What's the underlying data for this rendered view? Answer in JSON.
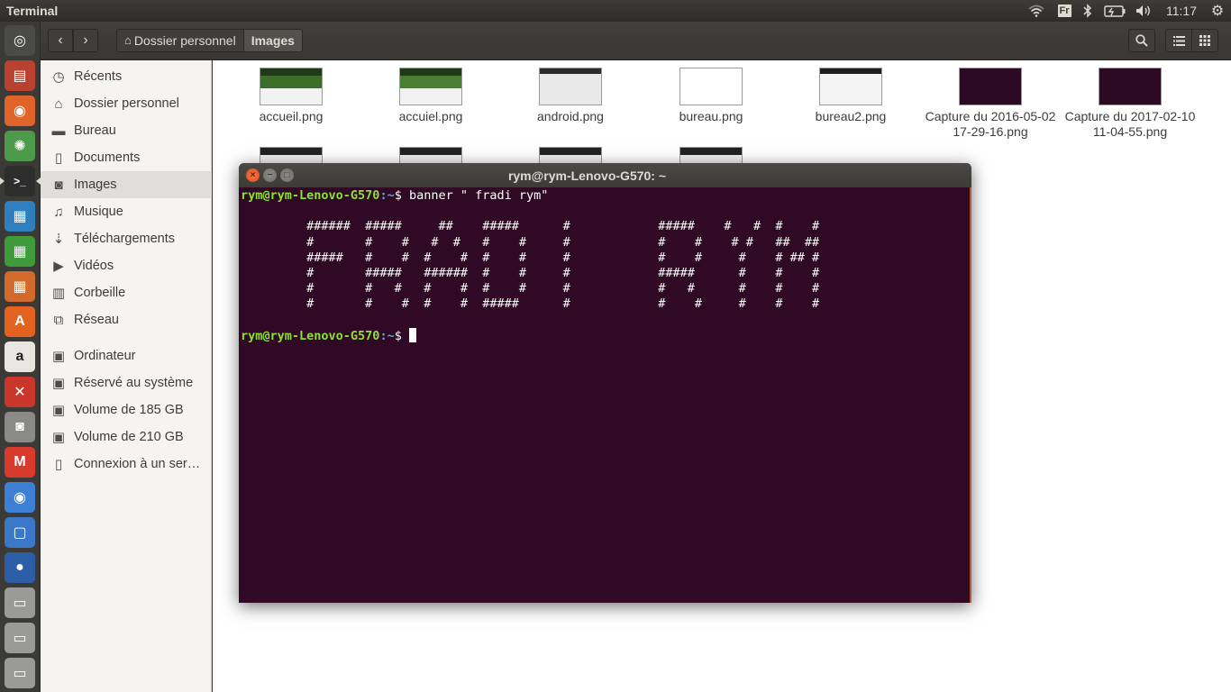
{
  "top_panel": {
    "app_title": "Terminal",
    "keyboard_layout": "Fr",
    "clock": "11:17"
  },
  "launcher": {
    "items": [
      {
        "name": "ubuntu-dash-icon",
        "color": "#4a4a48"
      },
      {
        "name": "file-manager-icon",
        "color": "#b8422f"
      },
      {
        "name": "firefox-icon",
        "color": "#e0632a"
      },
      {
        "name": "ubuntu-software-icon",
        "color": "#4c9a4a"
      },
      {
        "name": "terminal-icon",
        "color": "#2d2d2d"
      },
      {
        "name": "libreoffice-writer-icon",
        "color": "#2f7fc0"
      },
      {
        "name": "libreoffice-calc-icon",
        "color": "#3e9a3a"
      },
      {
        "name": "libreoffice-impress-icon",
        "color": "#d26a2b"
      },
      {
        "name": "software-center-icon",
        "color": "#e3621f"
      },
      {
        "name": "amazon-icon",
        "color": "#e8e6e1"
      },
      {
        "name": "system-settings-icon",
        "color": "#c9372c"
      },
      {
        "name": "camera-icon",
        "color": "#8a8a88"
      },
      {
        "name": "gmail-icon",
        "color": "#d93a2e"
      },
      {
        "name": "chromium-icon",
        "color": "#3d7fd4"
      },
      {
        "name": "screen-icon",
        "color": "#3c78c8"
      },
      {
        "name": "webcam-icon",
        "color": "#2c5ea8"
      },
      {
        "name": "drive-1-icon",
        "color": "#9a9a98"
      },
      {
        "name": "drive-2-icon",
        "color": "#9a9a98"
      },
      {
        "name": "drive-3-icon",
        "color": "#9a9a98"
      }
    ]
  },
  "file_manager": {
    "breadcrumbs": [
      "Dossier personnel",
      "Images"
    ],
    "sidebar": [
      {
        "label": "Récents",
        "icon": "clock-icon"
      },
      {
        "label": "Dossier personnel",
        "icon": "home-icon"
      },
      {
        "label": "Bureau",
        "icon": "folder-icon"
      },
      {
        "label": "Documents",
        "icon": "document-icon"
      },
      {
        "label": "Images",
        "icon": "camera-icon"
      },
      {
        "label": "Musique",
        "icon": "music-icon"
      },
      {
        "label": "Téléchargements",
        "icon": "download-icon"
      },
      {
        "label": "Vidéos",
        "icon": "video-icon"
      },
      {
        "label": "Corbeille",
        "icon": "trash-icon"
      },
      {
        "label": "Réseau",
        "icon": "network-icon"
      },
      {
        "label": "Ordinateur",
        "icon": "drive-icon"
      },
      {
        "label": "Réservé au système",
        "icon": "drive-icon"
      },
      {
        "label": "Volume de 185 GB",
        "icon": "drive-icon"
      },
      {
        "label": "Volume de 210 GB",
        "icon": "drive-icon"
      },
      {
        "label": "Connexion à un ser…",
        "icon": "server-icon"
      }
    ],
    "files": [
      {
        "name": "accueil.png"
      },
      {
        "name": "accuiel.png"
      },
      {
        "name": "android.png"
      },
      {
        "name": "bureau.png"
      },
      {
        "name": "bureau2.png"
      },
      {
        "name": "Capture du 2016-05-02 17-29-16.png"
      },
      {
        "name": "Capture du 2017-02-10 11-04-55.png"
      }
    ]
  },
  "terminal": {
    "title": "rym@rym-Lenovo-G570: ~",
    "prompt_user": "rym@rym-Lenovo-G570",
    "prompt_path": ":~",
    "prompt_symbol": "$ ",
    "command": "banner \" fradi rym\"",
    "banner_output": [
      "",
      "         ######  #####     ##    #####      #            #####    #   #  #    #",
      "         #       #    #   #  #   #    #     #            #    #    # #   ##  ##",
      "         #####   #    #  #    #  #    #     #            #    #     #    # ## #",
      "         #       #####   ######  #    #     #            #####      #    #    #",
      "         #       #   #   #    #  #    #     #            #   #      #    #    #",
      "         #       #    #  #    #  #####      #            #    #     #    #    #",
      ""
    ]
  }
}
